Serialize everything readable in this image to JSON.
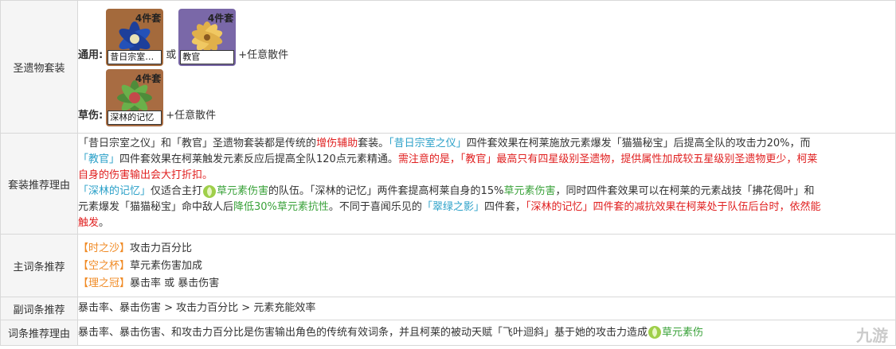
{
  "rows": {
    "sets": {
      "header": "圣遗物套装",
      "general_label": "通用:",
      "or_text": "或",
      "plus_text": "+任意散件",
      "set1": {
        "badge": "4件套",
        "name": "昔日宗室…"
      },
      "set2": {
        "badge": "4件套",
        "name": "教官"
      },
      "dendro_label": "草伤:",
      "set3": {
        "badge": "4件套",
        "name": "深林的记忆"
      },
      "plus_text2": "+任意散件"
    },
    "reason": {
      "header": "套装推荐理由",
      "l1": [
        "「昔日宗室之仪」",
        "和",
        "「教官」",
        "圣遗物套装都是传统的",
        "增伤辅助",
        "套装。",
        "「昔日宗室之仪」",
        "四件套效果在柯莱施放元素爆发「猫猫秘宝」后提高全队的攻击力20%，而"
      ],
      "l2": [
        "「教官」",
        "四件套效果在柯莱触发元素反应后提高全队120点元素精通。",
        "需注意的是，",
        "「教官」",
        "最高只有四星级别圣遗物，提供属性加成较五星级别圣遗物更少，柯莱"
      ],
      "l3": [
        "自身的伤害输出会大打折扣。"
      ],
      "l4": [
        "「深林的记忆」",
        "仅适合主打",
        "草元素伤害",
        "的队伍。「深林的记忆」两件套提高柯莱自身的15%",
        "草元素伤害",
        "，同时四件套效果可以在柯莱的元素战技「拂花偈叶」和"
      ],
      "l5": [
        "元素爆发「猫猫秘宝」命中敌人后",
        "降低30%草元素抗性",
        "。不同于喜闻乐见的",
        "「翠绿之影」",
        "四件套，",
        "「深林的记忆」四件套的减抗效果在柯莱处于队伍后台时，依然能"
      ],
      "l6": [
        "触发",
        "。"
      ]
    },
    "main": {
      "header": "主词条推荐",
      "items": [
        {
          "slot": "【时之沙】",
          "stat": "攻击力百分比"
        },
        {
          "slot": "【空之杯】",
          "stat": "草元素伤害加成"
        },
        {
          "slot": "【理之冠】",
          "stat": "暴击率 或 暴击伤害"
        }
      ]
    },
    "sub": {
      "header": "副词条推荐",
      "text": "暴击率、暴击伤害 > 攻击力百分比 > 元素充能效率"
    },
    "subreason": {
      "header": "词条推荐理由",
      "text": "暴击率、暴击伤害、和攻击力百分比是伤害输出角色的传统有效词条，并且柯莱的被动天赋「飞叶迴斜」基于她的攻击力造成",
      "tail": "草元素伤"
    }
  },
  "watermark": "九游",
  "colors": {
    "quote": "#2aa0c8",
    "red": "#e02020",
    "green": "#3aa23a",
    "orange": "#f08a24"
  }
}
